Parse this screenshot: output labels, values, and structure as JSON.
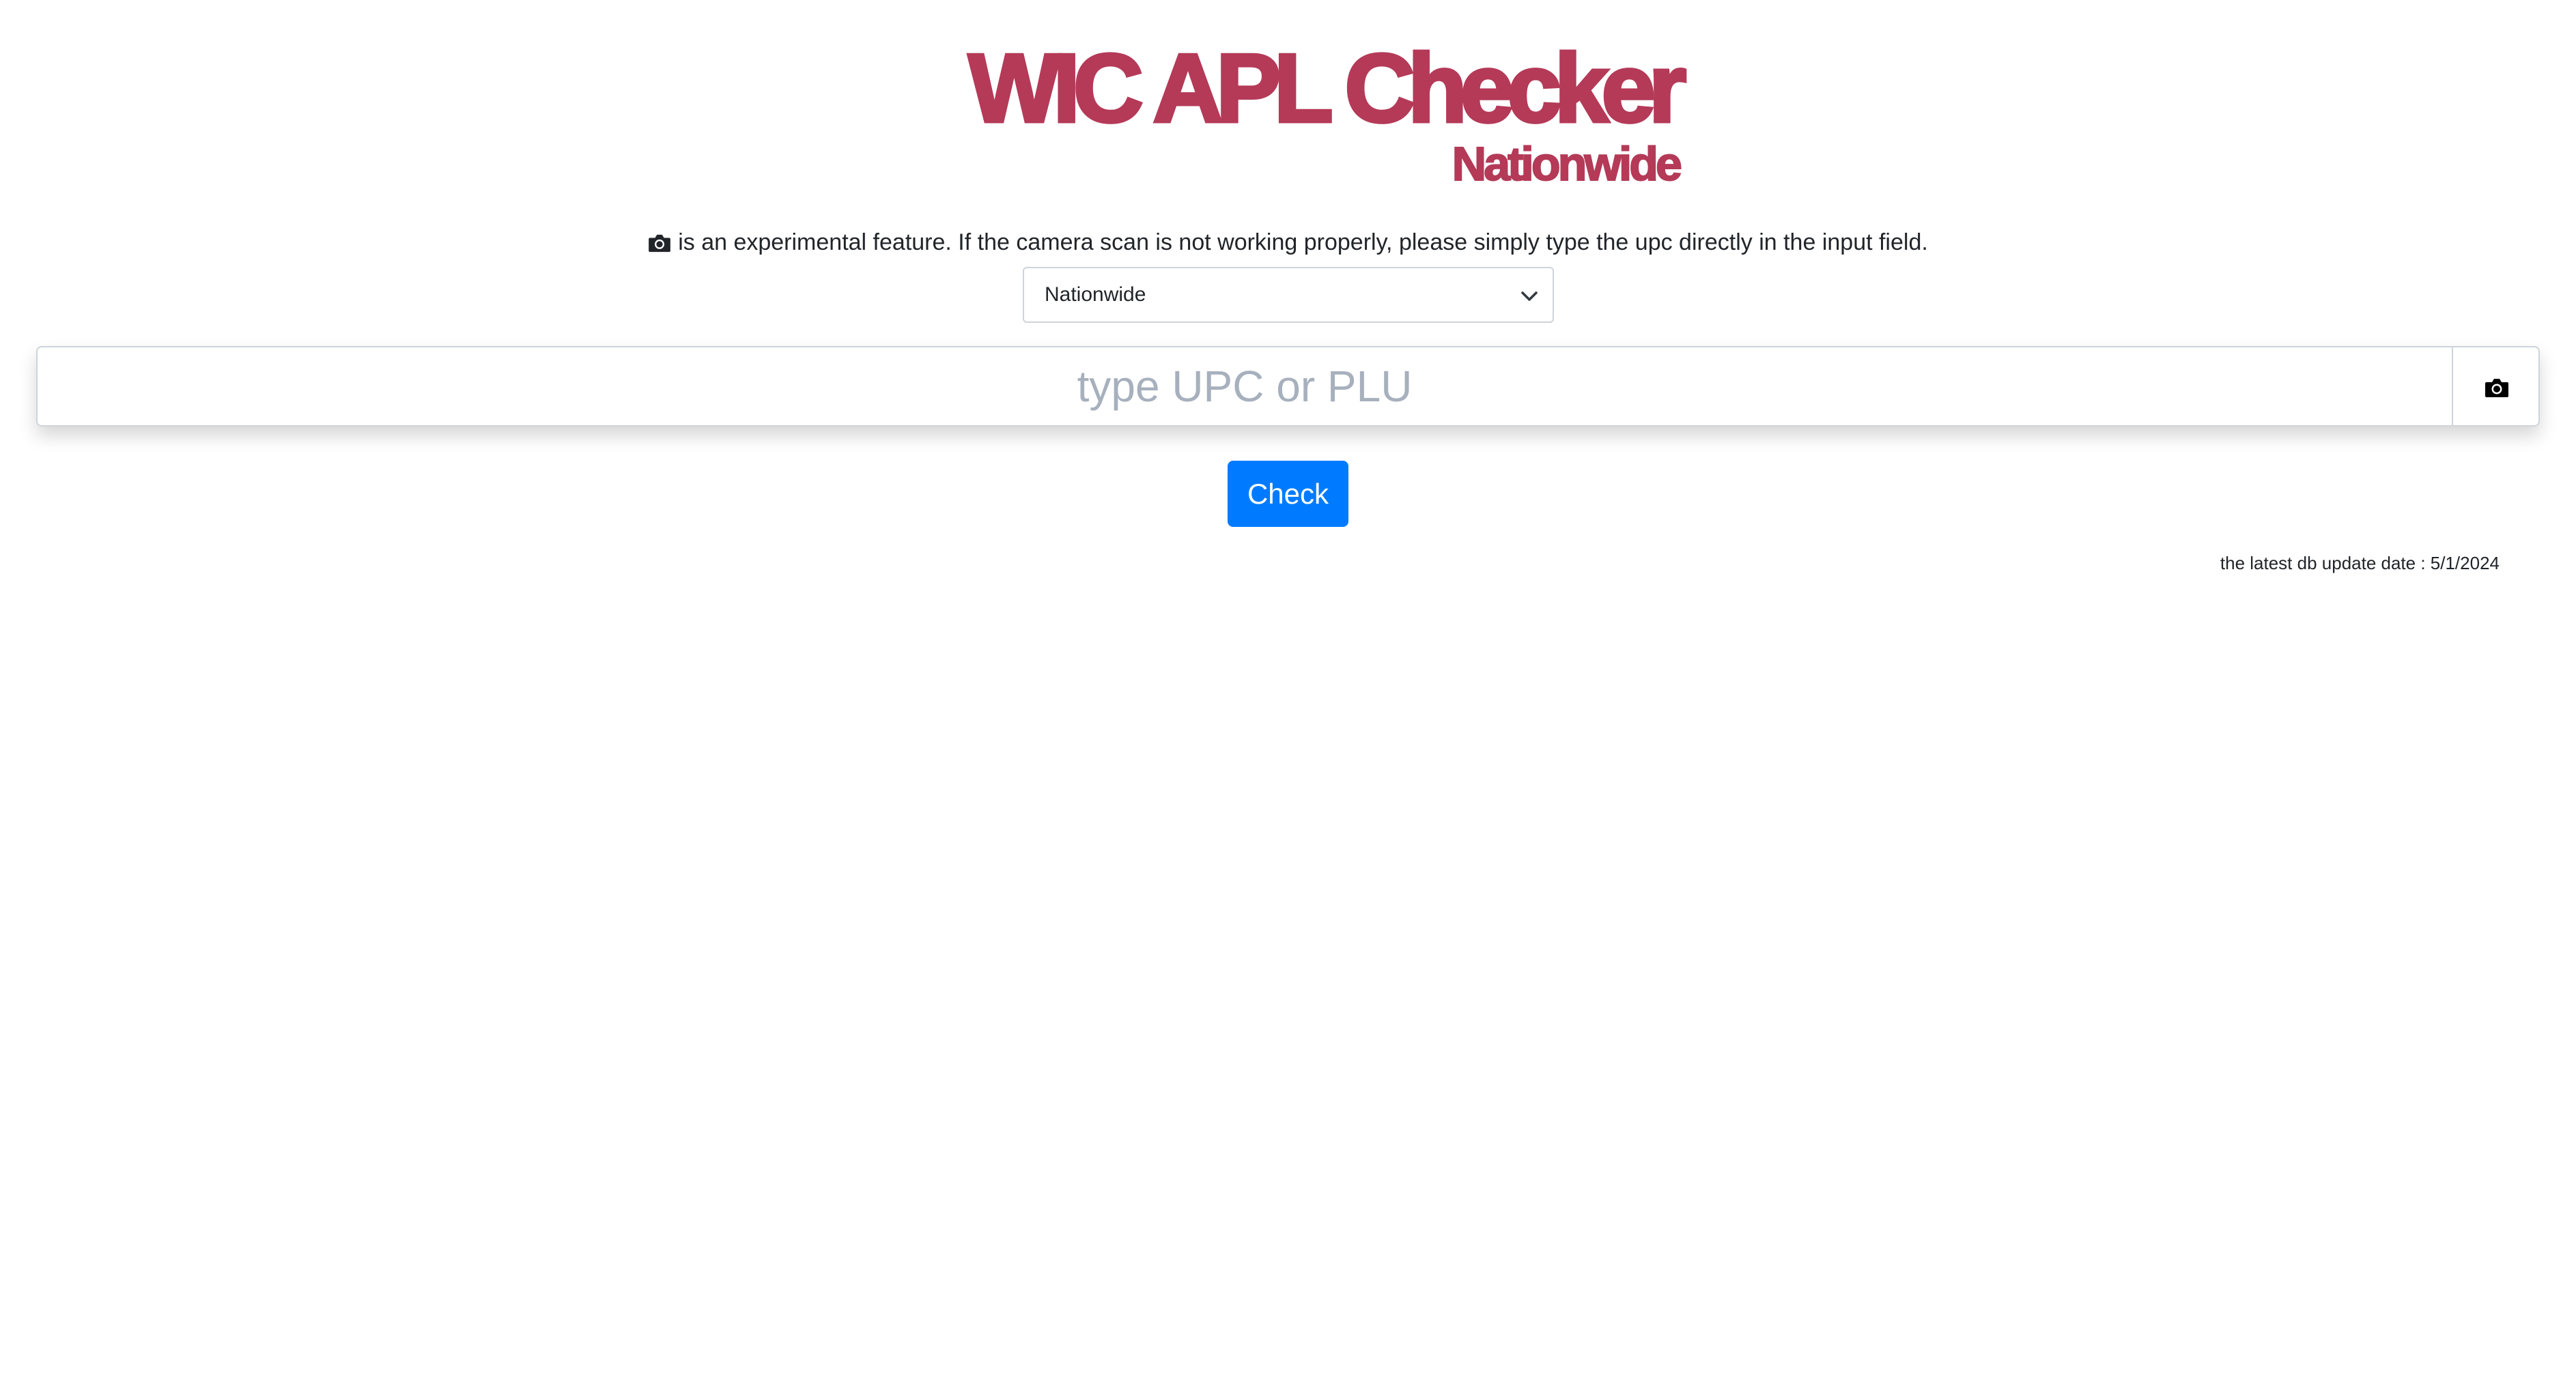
{
  "logo": {
    "title": "WIC APL Checker",
    "subtitle": "Nationwide",
    "color": "#b43a58"
  },
  "notice": {
    "icon": "camera-icon",
    "text": "is an experimental feature. If the camera scan is not working properly, please simply type the upc directly in the input field."
  },
  "region_select": {
    "selected": "Nationwide",
    "icon": "chevron-down-icon"
  },
  "search": {
    "placeholder": "type UPC or PLU",
    "value": "",
    "camera_button_icon": "camera-icon"
  },
  "check_button": {
    "label": "Check",
    "color": "#007bff"
  },
  "footer": {
    "update_date": "the latest db update date : 5/1/2024"
  }
}
